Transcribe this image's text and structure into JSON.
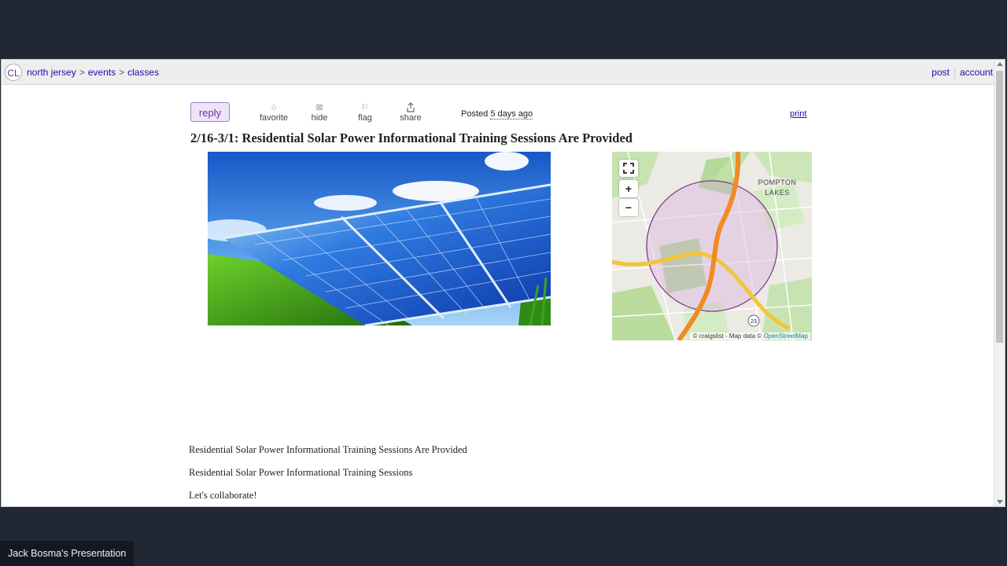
{
  "breadcrumb": {
    "logo": "CL",
    "items": [
      "north jersey",
      "events",
      "classes"
    ],
    "separator": ">"
  },
  "top_links": {
    "post": "post",
    "account": "account"
  },
  "actions": {
    "reply": "reply",
    "favorite": "favorite",
    "hide": "hide",
    "flag": "flag",
    "share": "share",
    "posted_label": "Posted",
    "posted_time": "5 days ago",
    "print": "print"
  },
  "posting": {
    "title": "2/16-3/1: Residential Solar Power Informational Training Sessions Are Provided",
    "body": [
      "Residential Solar Power Informational Training Sessions Are Provided",
      "Residential Solar Power Informational Training Sessions",
      "Let's collaborate!"
    ]
  },
  "map": {
    "place_label_1": "POMPTON",
    "place_label_2": "LAKES",
    "route_shield": "23",
    "attribution_prefix": "© craigslist - Map data ©",
    "attribution_link": "OpenStreetMap",
    "zoom_in": "+",
    "zoom_out": "−",
    "fullscreen": "⛶"
  },
  "presenter": {
    "label": "Jack Bosma's Presentation"
  }
}
